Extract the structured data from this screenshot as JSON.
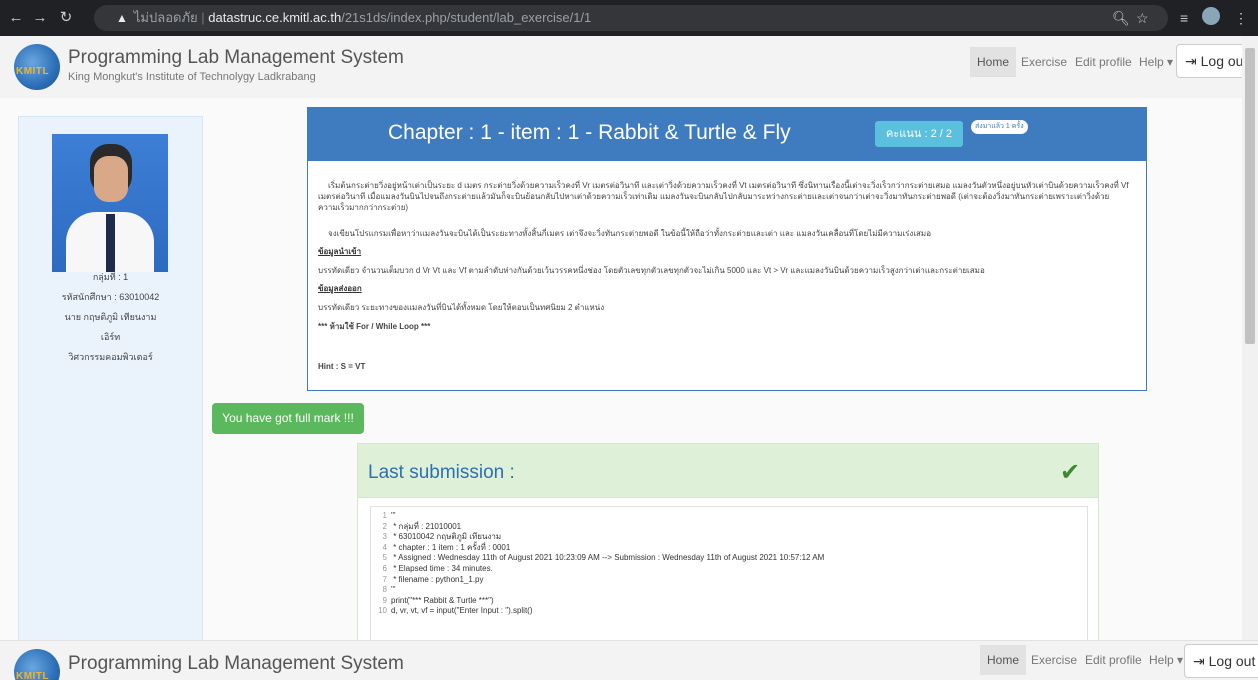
{
  "browser": {
    "security_label": "ไม่ปลอดภัย",
    "url_host": "datastruc.ce.kmitl.ac.th",
    "url_path": "/21s1ds/index.php/student/lab_exercise/1/1"
  },
  "site": {
    "logo_text": "KMITL",
    "title": "Programming Lab Management System",
    "subtitle": "King Mongkut's Institute of Technolygy Ladkrabang",
    "nav": {
      "home": "Home",
      "exercise": "Exercise",
      "edit_profile": "Edit profile",
      "help": "Help ▾",
      "logout": "Log out"
    }
  },
  "sidebar": {
    "group": "กลุ่มที่ : 1",
    "student_id": "รหัสนักศึกษา : 63010042",
    "name": "นาย กฤษติภูมิ เทียนงาม",
    "nickname": "เอิร์ท",
    "major": "วิศวกรรมคอมพิวเตอร์"
  },
  "chapter": {
    "title": "Chapter : 1 - item : 1 - Rabbit & Turtle & Fly",
    "score": "คะแนน : 2 / 2",
    "sent": "ส่งมาแล้ว 1 ครั้ง",
    "para1": "เริ่มต้นกระต่ายวิ่งอยู่หน้าเต่าเป็นระยะ d เมตร กระต่ายวิ่งด้วยความเร็วคงที่ Vr เมตรต่อวินาที และเต่าวิ่งด้วยความเร็วคงที่ Vt เมตรต่อวินาที ซึ่งนิทานเรื่องนี้เต่าจะวิ่งเร็วกว่ากระต่ายเสมอ แมลงวันตัวหนึ่งอยู่บนหัวเต่าบินด้วยความเร็วคงที่ Vf เมตรต่อวินาที เมื่อแมลงวันบินไปจนถึงกระต่ายแล้วมันก็จะบินย้อนกลับไปหาเต่าด้วยความเร็วเท่าเดิม แมลงวันจะบินกลับไปกลับมาระหว่างกระต่ายและเต่าจนกว่าเต่าจะวิ่งมาทันกระต่ายพอดี (เต่าจะต้องวิ่งมาทันกระต่ายเพราะเต่าวิ่งด้วยความเร็วมากกว่ากระต่าย)",
    "para2": "จงเขียนโปรแกรมเพื่อหาว่าแมลงวันจะบินได้เป็นระยะทางทั้งสิ้นกี่เมตร เต่าจึงจะวิ่งทันกระต่ายพอดี ในข้อนี้ให้ถือว่าทั้งกระต่ายและเต่า และ แมลงวันเคลื่อนที่โดยไม่มีความเร่งเสมอ",
    "input_heading": "ข้อมูลนำเข้า",
    "input_text": "บรรทัดเดียว จำนวนเต็มบวก d Vr Vt และ Vf ตามลำดับห่างกันด้วยเว้นวรรคหนึ่งช่อง โดยตัวเลขทุกตัวเลขทุกตัวจะไม่เกิน 5000 และ Vt > Vr และแมลงวันบินด้วยความเร็วสูงกว่าเต่าและกระต่ายเสมอ",
    "output_heading": "ข้อมูลส่งออก",
    "output_text": "บรรทัดเดียว ระยะทางของแมลงวันที่บินได้ทั้งหมด โดยให้ตอบเป็นทศนิยม 2 ตำแหน่ง",
    "rule": "*** ห้ามใช้ For / While Loop ***",
    "hint": "Hint : S = VT"
  },
  "fullmark_label": "You have got full mark !!!",
  "submission": {
    "title": "Last submission :",
    "code": [
      {
        "n": "1",
        "t": "'''"
      },
      {
        "n": "2",
        "t": " * กลุ่มที่  : 21010001"
      },
      {
        "n": "3",
        "t": " * 63010042 กฤษติภูมิ เทียนงาม"
      },
      {
        "n": "4",
        "t": " * chapter : 1  item : 1    ครั้งที่ : 0001"
      },
      {
        "n": "5",
        "t": " * Assigned : Wednesday 11th of August 2021 10:23:09 AM --> Submission : Wednesday 11th of August 2021 10:57:12 AM"
      },
      {
        "n": "6",
        "t": " * Elapsed time : 34 minutes."
      },
      {
        "n": "7",
        "t": " * filename : python1_1.py"
      },
      {
        "n": "8",
        "t": "'''"
      },
      {
        "n": "9",
        "t": "print(\"*** Rabbit & Turtle ***\")"
      },
      {
        "n": "10",
        "t": "d, vr, vt, vf = input(\"Enter Input : \").split()"
      }
    ]
  }
}
